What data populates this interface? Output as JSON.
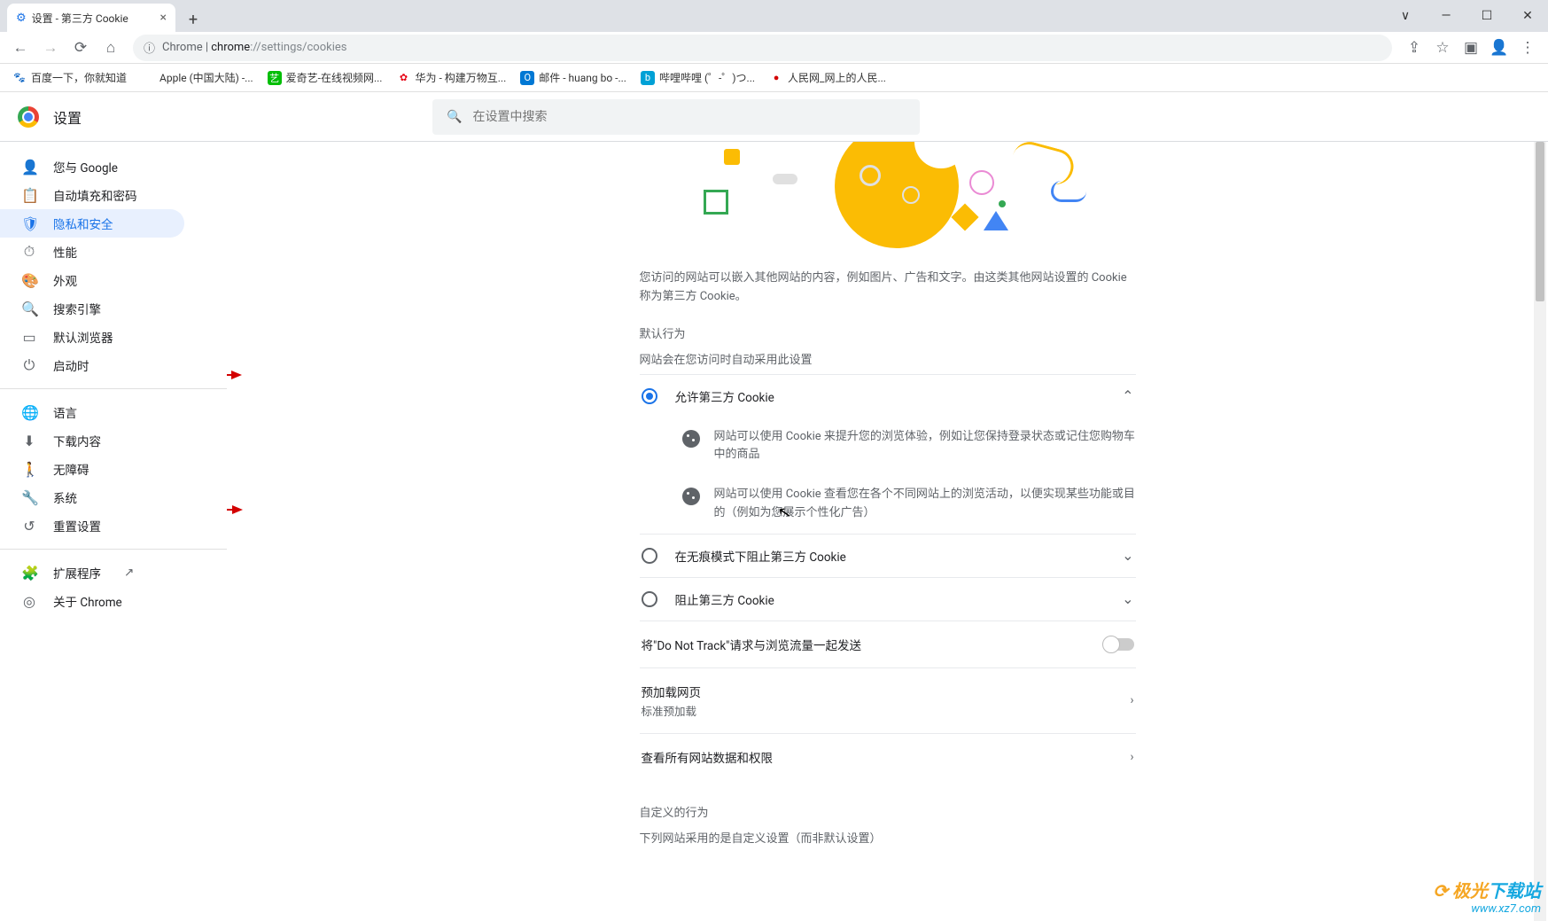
{
  "window": {
    "tab_title": "设置 - 第三方 Cookie"
  },
  "addressbar": {
    "prefix": "Chrome",
    "url_strong": "chrome",
    "url_rest": "://settings/cookies"
  },
  "bookmarks": [
    {
      "label": "百度一下，你就知道"
    },
    {
      "label": "Apple (中国大陆) -..."
    },
    {
      "label": "爱奇艺-在线视频网..."
    },
    {
      "label": "华为 - 构建万物互..."
    },
    {
      "label": "邮件 - huang bo -..."
    },
    {
      "label": "哔哩哔哩 (゜-゜)つ..."
    },
    {
      "label": "人民网_网上的人民..."
    }
  ],
  "header": {
    "title": "设置",
    "search_placeholder": "在设置中搜索"
  },
  "sidebar": {
    "items": [
      {
        "icon": "person",
        "label": "您与 Google"
      },
      {
        "icon": "autofill",
        "label": "自动填充和密码"
      },
      {
        "icon": "shield",
        "label": "隐私和安全",
        "active": true
      },
      {
        "icon": "speed",
        "label": "性能"
      },
      {
        "icon": "palette",
        "label": "外观"
      },
      {
        "icon": "search",
        "label": "搜索引擎"
      },
      {
        "icon": "browser",
        "label": "默认浏览器"
      },
      {
        "icon": "power",
        "label": "启动时"
      }
    ],
    "items2": [
      {
        "icon": "globe",
        "label": "语言"
      },
      {
        "icon": "download",
        "label": "下载内容"
      },
      {
        "icon": "access",
        "label": "无障碍"
      },
      {
        "icon": "wrench",
        "label": "系统"
      },
      {
        "icon": "reset",
        "label": "重置设置"
      }
    ],
    "items3": [
      {
        "icon": "puzzle",
        "label": "扩展程序",
        "external": true
      },
      {
        "icon": "info",
        "label": "关于 Chrome"
      }
    ]
  },
  "content": {
    "desc": "您访问的网站可以嵌入其他网站的内容，例如图片、广告和文字。由这类其他网站设置的 Cookie 称为第三方 Cookie。",
    "default_heading": "默认行为",
    "default_sub": "网站会在您访问时自动采用此设置",
    "opt_allow": "允许第三方 Cookie",
    "opt_allow_detail1": "网站可以使用 Cookie 来提升您的浏览体验，例如让您保持登录状态或记住您购物车中的商品",
    "opt_allow_detail2": "网站可以使用 Cookie 查看您在各个不同网站上的浏览活动，以便实现某些功能或目的（例如为您展示个性化广告）",
    "opt_block_incognito": "在无痕模式下阻止第三方 Cookie",
    "opt_block": "阻止第三方 Cookie",
    "dnt": "将\"Do Not Track\"请求与浏览流量一起发送",
    "preload_title": "预加载网页",
    "preload_sub": "标准预加载",
    "view_all": "查看所有网站数据和权限",
    "custom_heading": "自定义的行为",
    "custom_sub": "下列网站采用的是自定义设置（而非默认设置）"
  },
  "watermark": {
    "line1_a": "极光",
    "line1_b": "下载站",
    "line2": "www.xz7.com"
  }
}
